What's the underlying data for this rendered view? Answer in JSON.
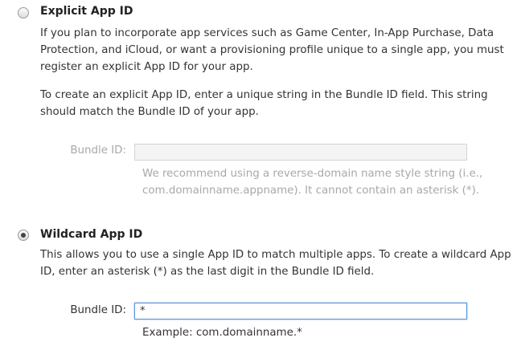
{
  "explicit": {
    "title": "Explicit App ID",
    "selected": false,
    "description_lines": [
      "If you plan to incorporate app services such as Game Center, In-App Purchase, Data",
      "Protection, and iCloud, or want a provisioning profile unique to a single app, you must",
      "register an explicit App ID for your app."
    ],
    "instructions_lines": [
      "To create an explicit App ID, enter a unique string in the Bundle ID field. This string",
      "should match the Bundle ID of your app."
    ],
    "bundle_label": "Bundle ID:",
    "bundle_value": "",
    "hint_lines": [
      "We recommend using a reverse-domain name style string (i.e.,",
      "com.domainname.appname). It cannot contain an asterisk (*)."
    ]
  },
  "wildcard": {
    "title": "Wildcard App ID",
    "selected": true,
    "description_lines": [
      "This allows you to use a single App ID to match multiple apps. To create a wildcard App",
      "ID, enter an asterisk (*) as the last digit in the Bundle ID field."
    ],
    "bundle_label": "Bundle ID:",
    "bundle_value": "*",
    "example": "Example: com.domainname.*"
  }
}
